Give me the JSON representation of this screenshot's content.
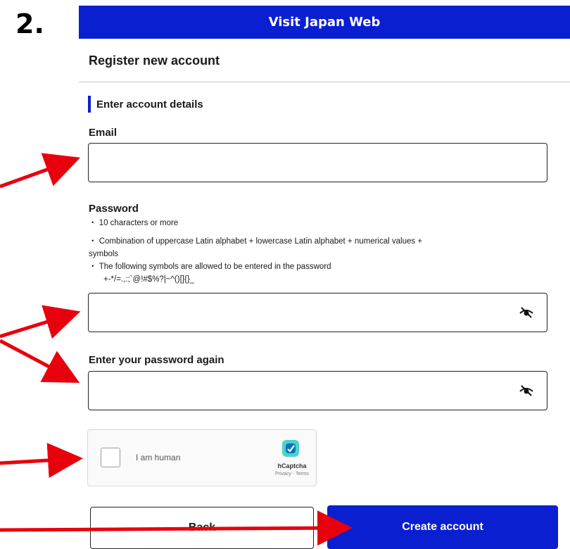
{
  "step_number": "2.",
  "header": {
    "title": "Visit Japan Web"
  },
  "page": {
    "title": "Register new account"
  },
  "section": {
    "heading": "Enter account details"
  },
  "email": {
    "label": "Email",
    "value": ""
  },
  "password": {
    "label": "Password",
    "value": "",
    "hints": [
      "・ 10 characters or more",
      "・ Combination of uppercase Latin alphabet + lowercase Latin alphabet + numerical values +",
      "symbols",
      "・ The following symbols are allowed to be entered in the password",
      "+-*/=.,:;`@!#$%?|~^()[]{}_"
    ]
  },
  "password_confirm": {
    "label": "Enter your password again",
    "value": ""
  },
  "captcha": {
    "label": "I am human",
    "brand": "hCaptcha",
    "links": "Privacy - Terms",
    "checked": false
  },
  "buttons": {
    "back": "Back",
    "create": "Create account"
  },
  "colors": {
    "brand_blue": "#0a1fd0",
    "annotation_red": "#e8000d"
  },
  "icons": {
    "password_toggle": "eye-slash-icon",
    "captcha_logo": "hcaptcha-logo-icon"
  }
}
